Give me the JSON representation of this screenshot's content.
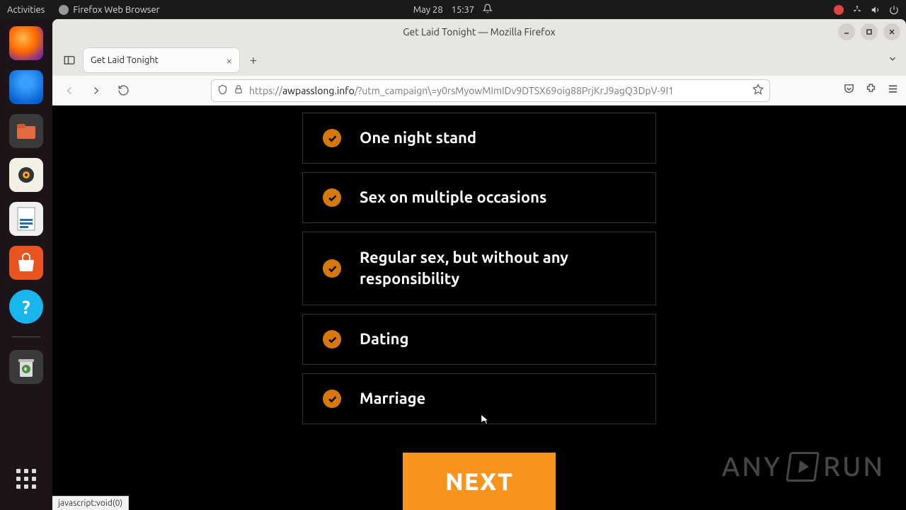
{
  "topbar": {
    "activities": "Activities",
    "app_name": "Firefox Web Browser",
    "date": "May 28",
    "time": "15:37"
  },
  "window": {
    "title": "Get Laid Tonight — Mozilla Firefox"
  },
  "tab": {
    "title": "Get Laid Tonight"
  },
  "url": {
    "scheme": "https://",
    "domain": "awpasslong.info",
    "path": "/?utm_campaign\\=y0rsMyowMImIDv9DTSX69oig88PrjKrJ9agQ3DpV-9I1"
  },
  "options": [
    {
      "label": "One night stand",
      "checked": true
    },
    {
      "label": "Sex on multiple occasions",
      "checked": true
    },
    {
      "label": "Regular sex, but without any responsibility",
      "checked": true
    },
    {
      "label": "Dating",
      "checked": true
    },
    {
      "label": "Marriage",
      "checked": true
    }
  ],
  "next_button": "NEXT",
  "status": "javascript:void(0)",
  "watermark": {
    "text1": "ANY",
    "text2": "RUN"
  }
}
